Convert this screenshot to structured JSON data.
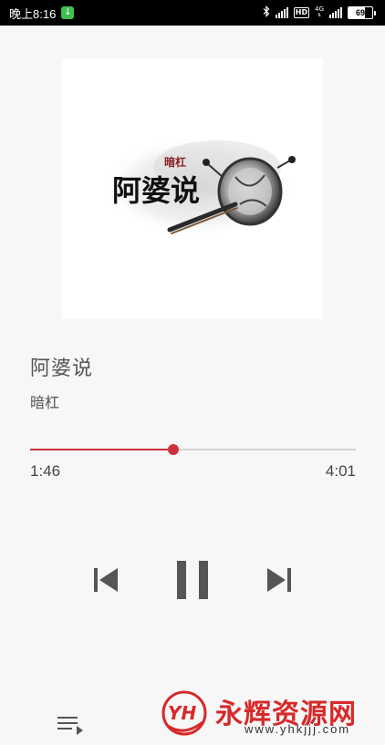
{
  "status_bar": {
    "time": "晚上8:16",
    "hd": "HD",
    "net_type": "4G",
    "battery": "69",
    "battery_level": 0.69
  },
  "album": {
    "art_artist_text": "暗杠",
    "art_title_text": "阿婆说"
  },
  "song": {
    "title": "阿婆说",
    "artist": "暗杠"
  },
  "playback": {
    "elapsed": "1:46",
    "total": "4:01",
    "progress": 0.44,
    "state": "playing"
  },
  "colors": {
    "accent": "#c9343c",
    "text": "#555555",
    "track": "#d3d3d3",
    "watermark": "#d62a2a"
  },
  "controls": {
    "prev_icon": "skip-previous-icon",
    "pause_icon": "pause-icon",
    "next_icon": "skip-next-icon",
    "queue_icon": "queue-icon"
  },
  "watermark": {
    "logo_text": "YH",
    "name": "永辉资源网",
    "url": "www.yhkjjj.com"
  }
}
